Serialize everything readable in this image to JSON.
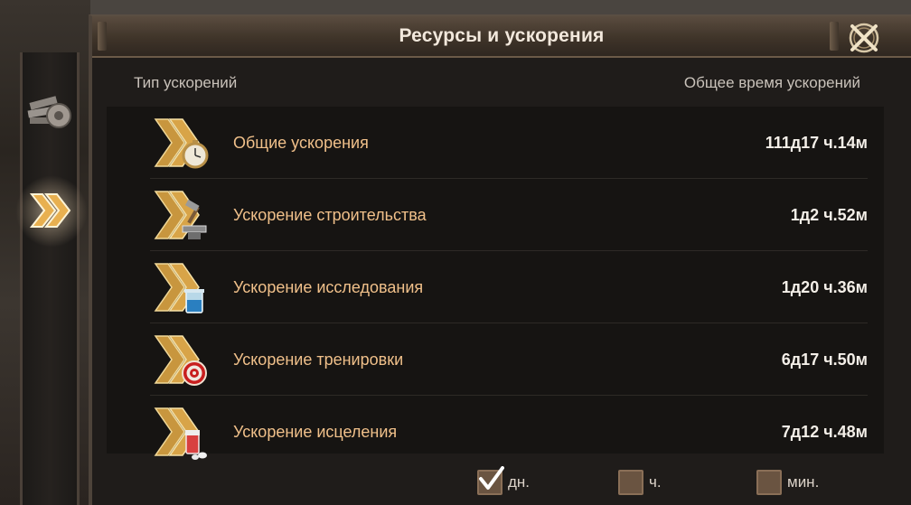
{
  "window": {
    "title": "Ресурсы и ускорения"
  },
  "side_tabs": [
    {
      "icon": "resources-icon",
      "active": false
    },
    {
      "icon": "speedup-chevrons-icon",
      "active": true
    }
  ],
  "columns": {
    "type_label": "Тип ускорений",
    "total_label": "Общее время ускорений"
  },
  "rows": [
    {
      "label": "Общие ускорения",
      "value": "111д17 ч.14м",
      "icon": "stopwatch-icon"
    },
    {
      "label": "Ускорение строительства",
      "value": "1д2 ч.52м",
      "icon": "anvil-hammer-icon"
    },
    {
      "label": "Ускорение исследования",
      "value": "1д20 ч.36м",
      "icon": "beaker-icon"
    },
    {
      "label": "Ускорение тренировки",
      "value": "6д17 ч.50м",
      "icon": "target-icon"
    },
    {
      "label": "Ускорение исцеления",
      "value": "7д12 ч.48м",
      "icon": "medicine-icon"
    }
  ],
  "filters": [
    {
      "label": "дн.",
      "checked": true
    },
    {
      "label": "ч.",
      "checked": false
    },
    {
      "label": "мин.",
      "checked": false
    }
  ],
  "colors": {
    "label_orange": "#f0c08a",
    "gold": "#d4a24a"
  }
}
